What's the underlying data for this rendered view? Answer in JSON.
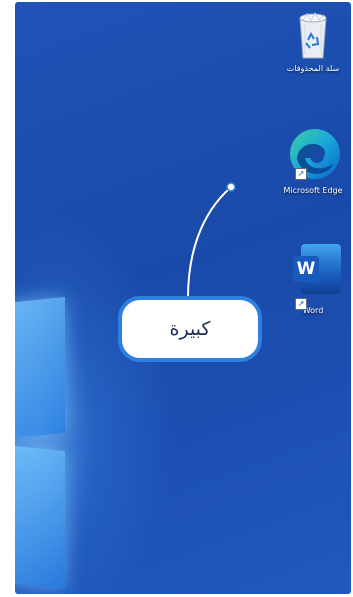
{
  "desktop": {
    "icons": [
      {
        "label": "سلة المحذوفات",
        "icon": "recycle-bin-icon",
        "shortcut": false
      },
      {
        "label": "Microsoft Edge",
        "icon": "edge-icon",
        "shortcut": true
      },
      {
        "label": "Word",
        "icon": "word-icon",
        "shortcut": true
      }
    ],
    "word_letter": "W"
  },
  "callout": {
    "text": "كبيرة",
    "border_color": "#2d7fe0"
  },
  "colors": {
    "desktop_bg": "#1f53b8",
    "accent": "#2d7fe0"
  }
}
